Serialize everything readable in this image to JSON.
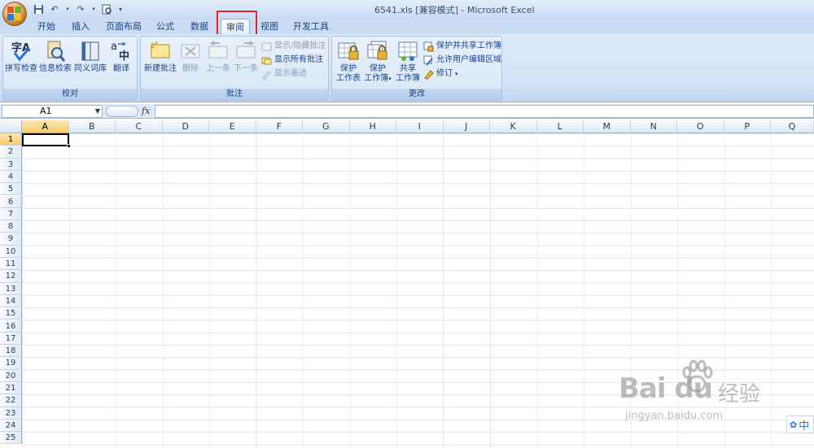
{
  "window": {
    "title": "6541.xls  [兼容模式] - Microsoft Excel"
  },
  "tabs": [
    {
      "label": "开始"
    },
    {
      "label": "插入"
    },
    {
      "label": "页面布局"
    },
    {
      "label": "公式"
    },
    {
      "label": "数据"
    },
    {
      "label": "审阅",
      "active": true
    },
    {
      "label": "视图"
    },
    {
      "label": "开发工具"
    }
  ],
  "ribbon": {
    "proofing": {
      "label": "校对",
      "spell": "拼写检查",
      "research": "信息检索",
      "thesaurus": "同义词库",
      "translate": "翻译"
    },
    "comments": {
      "label": "批注",
      "new": "新建批注",
      "delete": "删除",
      "prev": "上一条",
      "next": "下一条",
      "show_hide": "显示/隐藏批注",
      "show_all": "显示所有批注",
      "show_ink": "显示墨迹"
    },
    "changes": {
      "label": "更改",
      "protect_sheet_1": "保护",
      "protect_sheet_2": "工作表",
      "protect_wb_1": "保护",
      "protect_wb_2": "工作簿",
      "share_wb_1": "共享",
      "share_wb_2": "工作簿",
      "protect_share": "保护并共享工作簿",
      "allow_edit": "允许用户编辑区域",
      "track": "修订"
    }
  },
  "formula_bar": {
    "name_box": "A1",
    "fx": "fx",
    "formula": ""
  },
  "sheet": {
    "columns": [
      "A",
      "B",
      "C",
      "D",
      "E",
      "F",
      "G",
      "H",
      "I",
      "J",
      "K",
      "L",
      "M",
      "N",
      "O",
      "P",
      "Q"
    ],
    "rows": [
      "1",
      "2",
      "3",
      "4",
      "5",
      "6",
      "7",
      "8",
      "9",
      "10",
      "11",
      "12",
      "13",
      "14",
      "15",
      "16",
      "17",
      "18",
      "19",
      "20",
      "21",
      "22",
      "23",
      "24",
      "25"
    ],
    "active_cell": "A1"
  },
  "watermark": {
    "brand": "Bai du",
    "cn": "经验",
    "url": "jingyan.baidu.com"
  },
  "ime": {
    "label": "中"
  },
  "colors": {
    "accent": "#15428b",
    "ribbon": "#d3e3f6",
    "highlight": "#e0262a"
  }
}
